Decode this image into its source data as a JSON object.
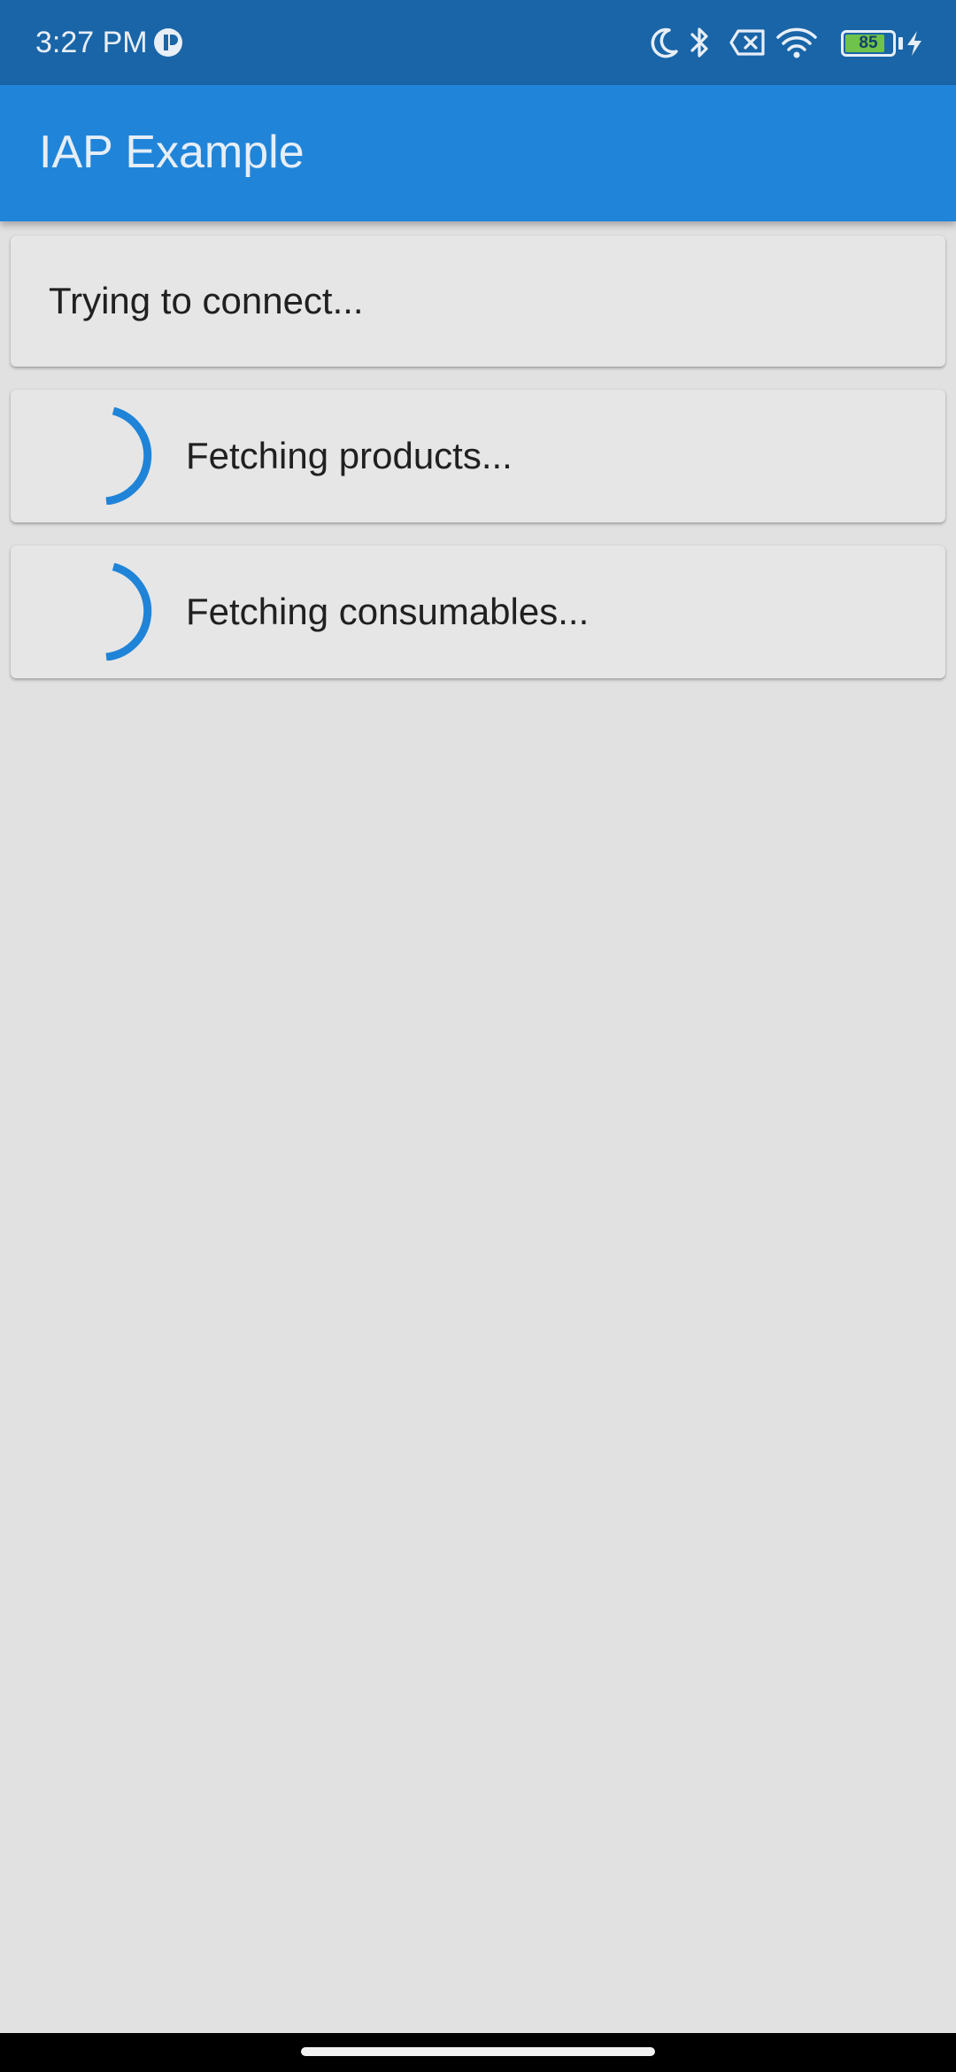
{
  "status_bar": {
    "time": "3:27 PM",
    "battery_level": "85",
    "battery_fraction": 0.85,
    "icons": [
      "app-notification-icon",
      "moon-icon",
      "bluetooth-icon",
      "no-sim-icon",
      "wifi-icon",
      "battery-icon",
      "charging-bolt-icon"
    ]
  },
  "app_bar": {
    "title": "IAP Example"
  },
  "cards": {
    "connect": {
      "text": "Trying to connect..."
    },
    "products": {
      "text": "Fetching products..."
    },
    "consumables": {
      "text": "Fetching consumables..."
    }
  },
  "colors": {
    "status_bar": "#1965a8",
    "app_bar": "#2085d9",
    "spinner": "#1f84d8",
    "background": "#e1e1e1",
    "card": "#e6e6e6"
  }
}
